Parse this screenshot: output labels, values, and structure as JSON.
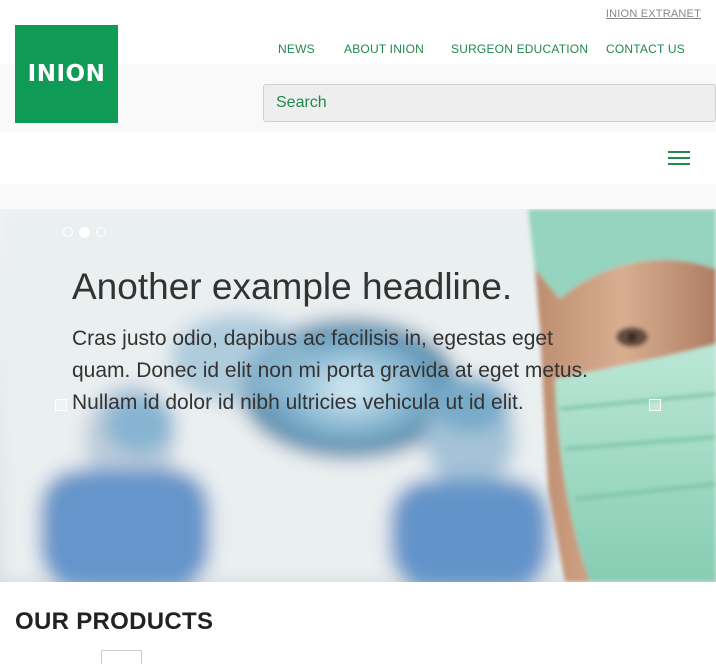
{
  "header": {
    "extranet_link": "INION EXTRANET",
    "logo_text": "INION",
    "brand_color": "#0f9a56",
    "link_color": "#1f8a4c"
  },
  "nav": {
    "items": [
      {
        "label": "NEWS"
      },
      {
        "label": "ABOUT INION"
      },
      {
        "label": "SURGEON EDUCATION"
      },
      {
        "label": "CONTACT US"
      }
    ]
  },
  "search": {
    "placeholder": "Search",
    "value": ""
  },
  "menu": {
    "icon": "hamburger-menu-icon"
  },
  "carousel": {
    "slide_count": 3,
    "active_index": 1,
    "headline": "Another example headline.",
    "body": "Cras justo odio, dapibus ac facilisis in, egestas eget quam. Donec id elit non mi porta gravida at eget metus. Nullam id dolor id nibh ultricies vehicula ut id elit.",
    "prev_icon": "previous-slide-icon",
    "next_icon": "next-slide-icon",
    "image": "surgeon-wearing-mask-photo"
  },
  "products": {
    "title": "OUR PRODUCTS"
  }
}
